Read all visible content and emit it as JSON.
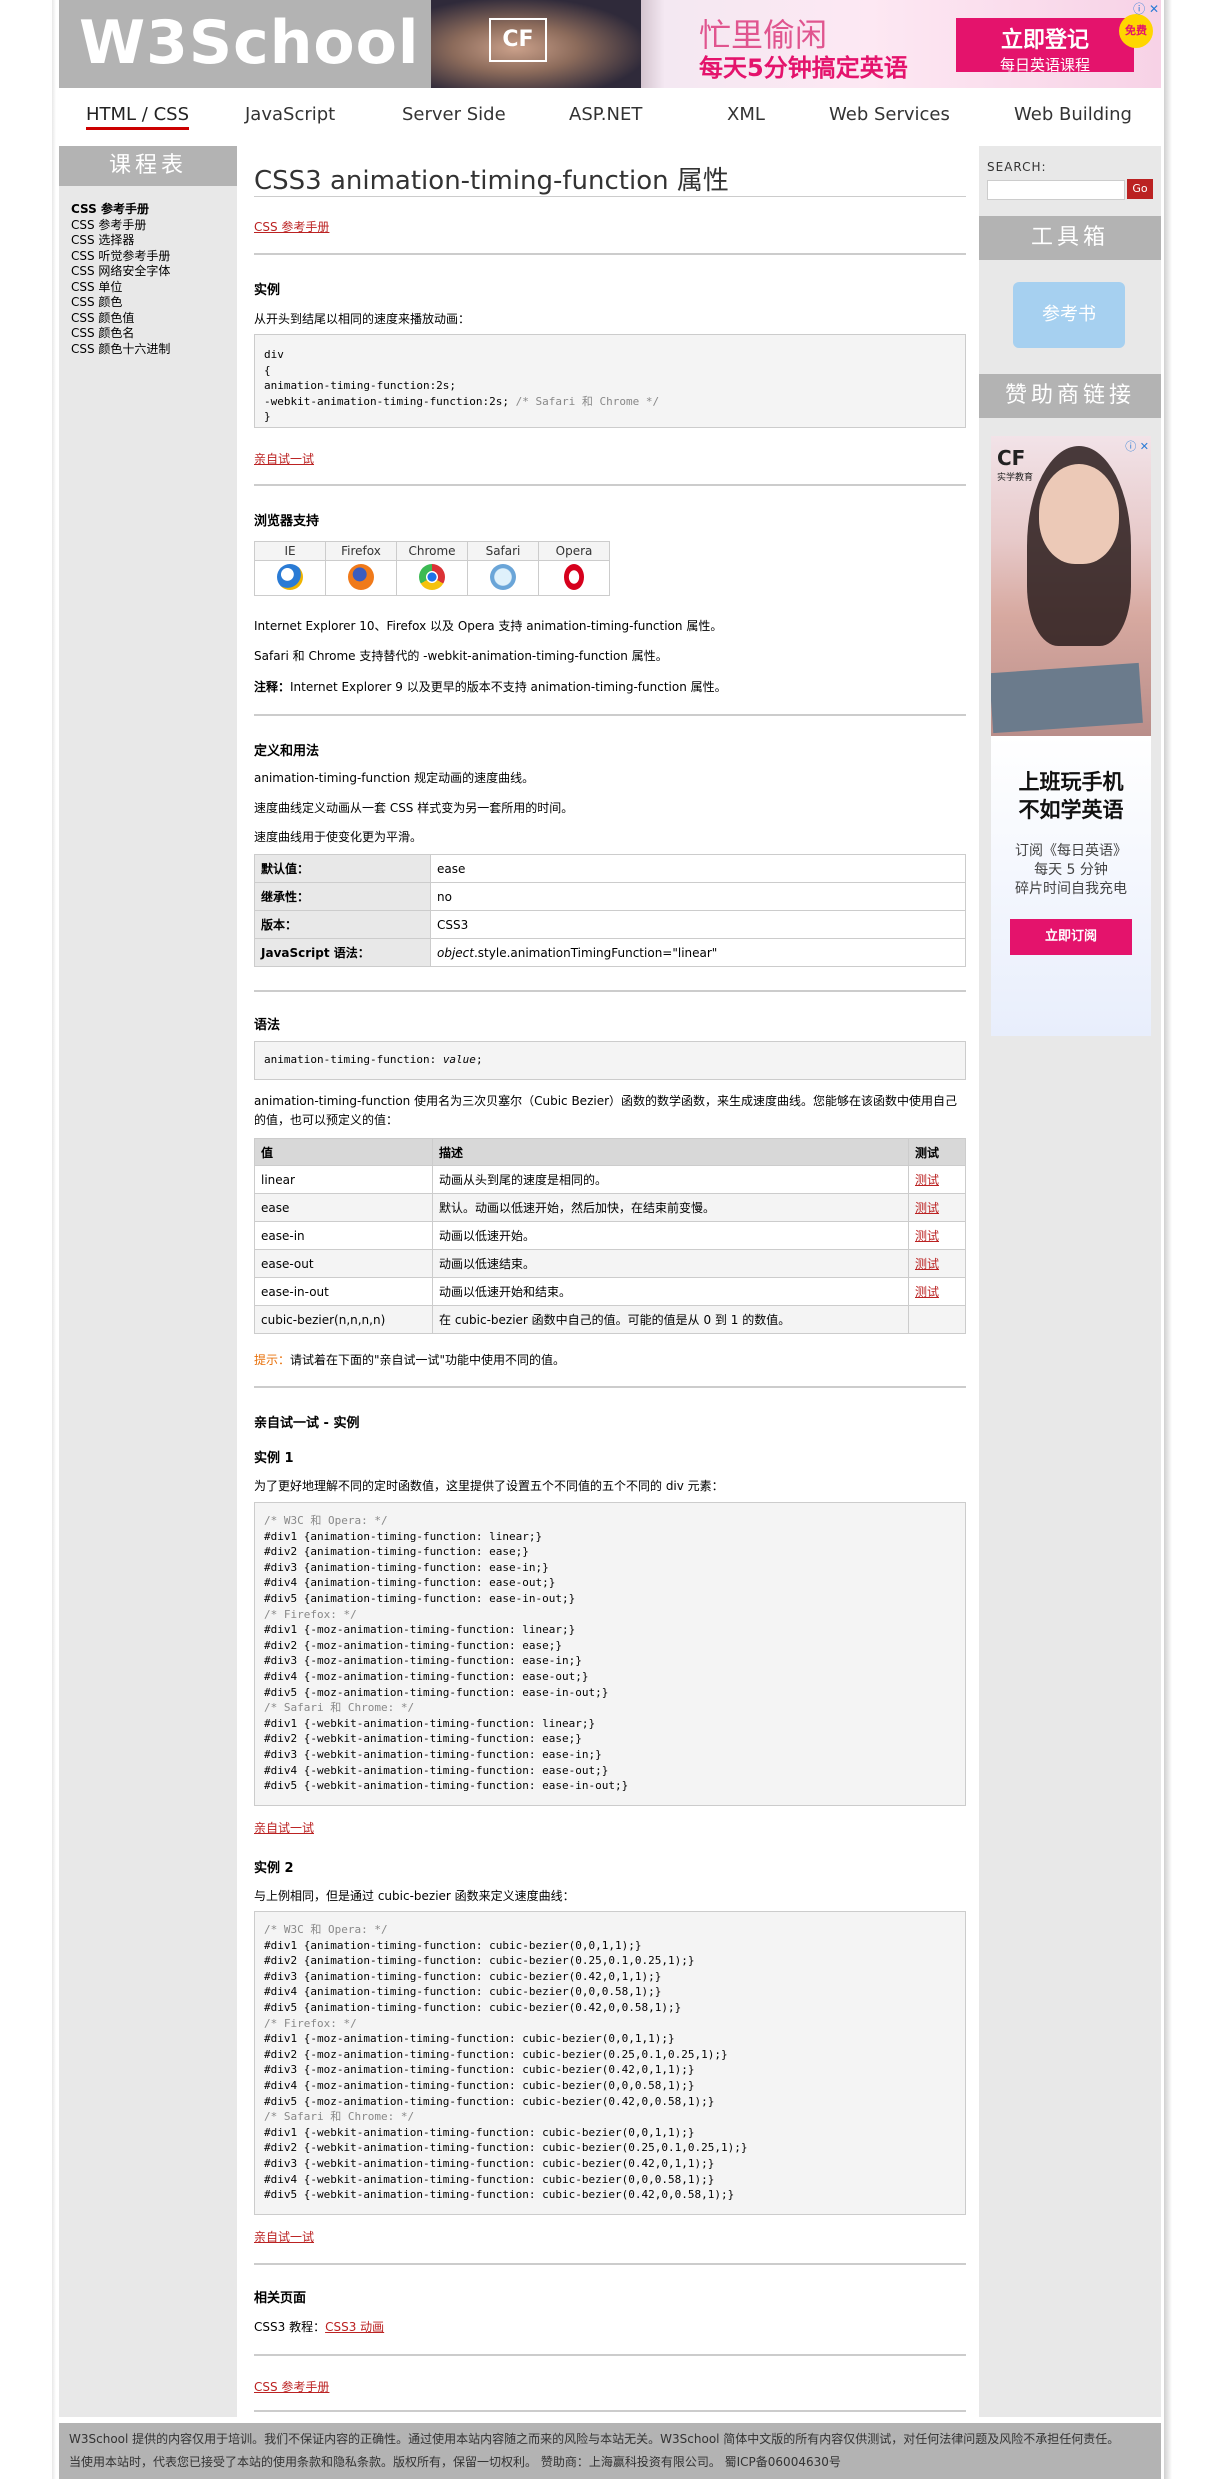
{
  "header": {
    "logo": "W3School",
    "banner": {
      "brand": "CF",
      "line1": "忙里偷闲",
      "line2": "每天5分钟搞定英语",
      "cta_main": "立即登记",
      "cta_sub": "每日英语课程",
      "badge": "免费",
      "close": "ⓘ ✕"
    }
  },
  "nav": {
    "items": [
      "HTML / CSS",
      "JavaScript",
      "Server Side",
      "ASP.NET",
      "XML",
      "Web Services",
      "Web Building"
    ]
  },
  "left": {
    "title": "课程表",
    "items": [
      "CSS 参考手册",
      "CSS 参考手册",
      "CSS 选择器",
      "CSS 听觉参考手册",
      "CSS 网络安全字体",
      "CSS 单位",
      "CSS 颜色",
      "CSS 颜色值",
      "CSS 颜色名",
      "CSS 颜色十六进制"
    ]
  },
  "right": {
    "search_label": "SEARCH:",
    "search_go": "Go",
    "toolbox_title": "工具箱",
    "reference_button": "参考书",
    "sponsor_title": "赞助商链接",
    "ad": {
      "logo": "CF",
      "logo_sub": "实学教育",
      "headline1": "上班玩手机",
      "headline2": "不如学英语",
      "sub1": "订阅《每日英语》",
      "sub2": "每天 5 分钟",
      "sub3": "碎片时间自我充电",
      "button": "立即订阅",
      "close": "ⓘ ✕"
    }
  },
  "main": {
    "title": "CSS3 animation-timing-function 属性",
    "ref_link": "CSS 参考手册",
    "example": {
      "heading": "实例",
      "desc": "从开头到结尾以相同的速度来播放动画：",
      "code_lines": [
        "div",
        "{",
        "animation-timing-function:2s;"
      ],
      "code_last_prefix": "-webkit-animation-timing-function:2s; ",
      "code_last_comment": "/* Safari 和 Chrome */",
      "code_close": "}",
      "try_link": "亲自试一试"
    },
    "browser": {
      "heading": "浏览器支持",
      "names": [
        "IE",
        "Firefox",
        "Chrome",
        "Safari",
        "Opera"
      ],
      "p1": "Internet Explorer 10、Firefox 以及 Opera 支持 animation-timing-function 属性。",
      "p2": "Safari 和 Chrome 支持替代的 -webkit-animation-timing-function 属性。",
      "p3_label": "注释：",
      "p3": "Internet Explorer 9 以及更早的版本不支持 animation-timing-function 属性。"
    },
    "definition": {
      "heading": "定义和用法",
      "p1": "animation-timing-function 规定动画的速度曲线。",
      "p2": "速度曲线定义动画从一套 CSS 样式变为另一套所用的时间。",
      "p3": "速度曲线用于使变化更为平滑。",
      "rows": [
        {
          "k": "默认值：",
          "v": "ease"
        },
        {
          "k": "继承性：",
          "v": "no"
        },
        {
          "k": "版本：",
          "v": "CSS3"
        }
      ],
      "js_key": "JavaScript 语法：",
      "js_obj": "object",
      "js_rest": ".style.animationTimingFunction=\"linear\""
    },
    "syntax": {
      "heading": "语法",
      "code_prefix": "animation-timing-function: ",
      "code_value": "value",
      "code_suffix": ";",
      "desc1": "animation-timing-function 使用名为三次贝塞尔（Cubic Bezier）函数的数学函数，来生成速度曲线。您能够在该函数中使用自己",
      "desc2": "的值，也可以预定义的值：",
      "headers": [
        "值",
        "描述",
        "测试"
      ],
      "rows": [
        {
          "value": "linear",
          "desc": "动画从头到尾的速度是相同的。",
          "test": "测试"
        },
        {
          "value": "ease",
          "desc": "默认。动画以低速开始，然后加快，在结束前变慢。",
          "test": "测试"
        },
        {
          "value": "ease-in",
          "desc": "动画以低速开始。",
          "test": "测试"
        },
        {
          "value": "ease-out",
          "desc": "动画以低速结束。",
          "test": "测试"
        },
        {
          "value": "ease-in-out",
          "desc": "动画以低速开始和结束。",
          "test": "测试"
        },
        {
          "value": "cubic-bezier(n,n,n,n)",
          "desc": "在 cubic-bezier 函数中自己的值。可能的值是从 0 到 1 的数值。",
          "test": ""
        }
      ],
      "tip_label": "提示：",
      "tip": "请试着在下面的\"亲自试一试\"功能中使用不同的值。"
    },
    "tryit": {
      "heading": "亲自试一试 - 实例",
      "ex1_heading": "实例 1",
      "ex1_desc": "为了更好地理解不同的定时函数值，这里提供了设置五个不同值的五个不同的 div 元素：",
      "ex1_code": [
        {
          "c": true,
          "t": "/* W3C 和 Opera: */"
        },
        {
          "c": false,
          "t": "#div1 {animation-timing-function: linear;}"
        },
        {
          "c": false,
          "t": "#div2 {animation-timing-function: ease;}"
        },
        {
          "c": false,
          "t": "#div3 {animation-timing-function: ease-in;}"
        },
        {
          "c": false,
          "t": "#div4 {animation-timing-function: ease-out;}"
        },
        {
          "c": false,
          "t": "#div5 {animation-timing-function: ease-in-out;}"
        },
        {
          "c": true,
          "t": "/* Firefox: */"
        },
        {
          "c": false,
          "t": "#div1 {-moz-animation-timing-function: linear;}"
        },
        {
          "c": false,
          "t": "#div2 {-moz-animation-timing-function: ease;}"
        },
        {
          "c": false,
          "t": "#div3 {-moz-animation-timing-function: ease-in;}"
        },
        {
          "c": false,
          "t": "#div4 {-moz-animation-timing-function: ease-out;}"
        },
        {
          "c": false,
          "t": "#div5 {-moz-animation-timing-function: ease-in-out;}"
        },
        {
          "c": true,
          "t": "/* Safari 和 Chrome: */"
        },
        {
          "c": false,
          "t": "#div1 {-webkit-animation-timing-function: linear;}"
        },
        {
          "c": false,
          "t": "#div2 {-webkit-animation-timing-function: ease;}"
        },
        {
          "c": false,
          "t": "#div3 {-webkit-animation-timing-function: ease-in;}"
        },
        {
          "c": false,
          "t": "#div4 {-webkit-animation-timing-function: ease-out;}"
        },
        {
          "c": false,
          "t": "#div5 {-webkit-animation-timing-function: ease-in-out;}"
        }
      ],
      "ex1_link": "亲自试一试",
      "ex2_heading": "实例 2",
      "ex2_desc": "与上例相同，但是通过 cubic-bezier 函数来定义速度曲线：",
      "ex2_code": [
        {
          "c": true,
          "t": "/* W3C 和 Opera: */"
        },
        {
          "c": false,
          "t": "#div1 {animation-timing-function: cubic-bezier(0,0,1,1);}"
        },
        {
          "c": false,
          "t": "#div2 {animation-timing-function: cubic-bezier(0.25,0.1,0.25,1);}"
        },
        {
          "c": false,
          "t": "#div3 {animation-timing-function: cubic-bezier(0.42,0,1,1);}"
        },
        {
          "c": false,
          "t": "#div4 {animation-timing-function: cubic-bezier(0,0,0.58,1);}"
        },
        {
          "c": false,
          "t": "#div5 {animation-timing-function: cubic-bezier(0.42,0,0.58,1);}"
        },
        {
          "c": true,
          "t": "/* Firefox: */"
        },
        {
          "c": false,
          "t": "#div1 {-moz-animation-timing-function: cubic-bezier(0,0,1,1);}"
        },
        {
          "c": false,
          "t": "#div2 {-moz-animation-timing-function: cubic-bezier(0.25,0.1,0.25,1);}"
        },
        {
          "c": false,
          "t": "#div3 {-moz-animation-timing-function: cubic-bezier(0.42,0,1,1);}"
        },
        {
          "c": false,
          "t": "#div4 {-moz-animation-timing-function: cubic-bezier(0,0,0.58,1);}"
        },
        {
          "c": false,
          "t": "#div5 {-moz-animation-timing-function: cubic-bezier(0.42,0,0.58,1);}"
        },
        {
          "c": true,
          "t": "/* Safari 和 Chrome: */"
        },
        {
          "c": false,
          "t": "#div1 {-webkit-animation-timing-function: cubic-bezier(0,0,1,1);}"
        },
        {
          "c": false,
          "t": "#div2 {-webkit-animation-timing-function: cubic-bezier(0.25,0.1,0.25,1);}"
        },
        {
          "c": false,
          "t": "#div3 {-webkit-animation-timing-function: cubic-bezier(0.42,0,1,1);}"
        },
        {
          "c": false,
          "t": "#div4 {-webkit-animation-timing-function: cubic-bezier(0,0,0.58,1);}"
        },
        {
          "c": false,
          "t": "#div5 {-webkit-animation-timing-function: cubic-bezier(0.42,0,0.58,1);}"
        }
      ],
      "ex2_link": "亲自试一试"
    },
    "related": {
      "heading": "相关页面",
      "label": "CSS3 教程：",
      "link": "CSS3 动画"
    },
    "bottom_ref_link": "CSS 参考手册"
  },
  "footer": {
    "line1": "W3School 提供的内容仅用于培训。我们不保证内容的正确性。通过使用本站内容随之而来的风险与本站无关。W3School 简体中文版的所有内容仅供测试，对任何法律问题及风险不承担任何责任。",
    "line2": "当使用本站时，代表您已接受了本站的使用条款和隐私条款。版权所有，保留一切权利。 赞助商：上海赢科投资有限公司。 蜀ICP备06004630号"
  }
}
